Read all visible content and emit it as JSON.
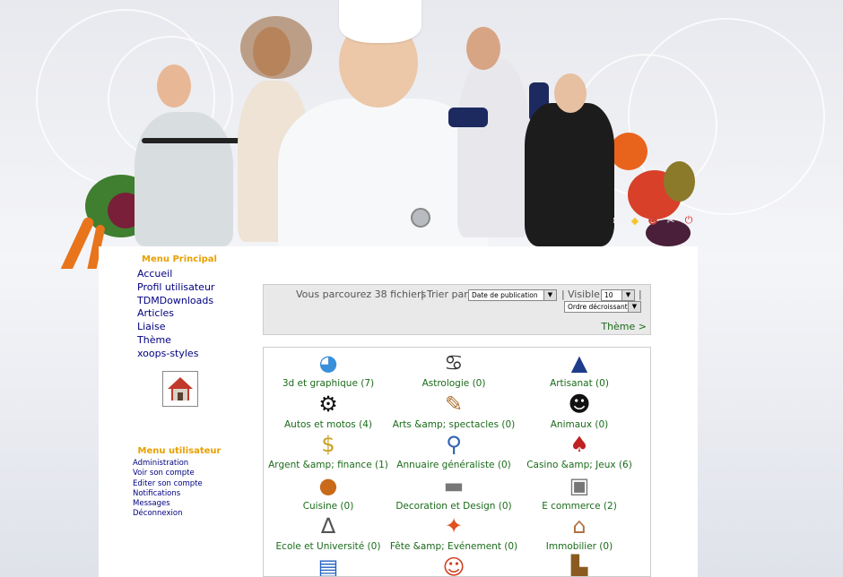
{
  "top_icons": [
    {
      "name": "mail-icon",
      "glyph": "✉",
      "color": "#f2f2f2"
    },
    {
      "name": "folder-icon",
      "glyph": "◆",
      "color": "#f4c430"
    },
    {
      "name": "profile-icon",
      "glyph": "☻",
      "color": "#d04030"
    },
    {
      "name": "tools-icon",
      "glyph": "✂",
      "color": "#ffffff"
    },
    {
      "name": "power-icon",
      "glyph": "⏻",
      "color": "#e02020"
    }
  ],
  "main_menu": {
    "title": "Menu Principal",
    "items": [
      "Accueil",
      "Profil utilisateur",
      "TDMDownloads",
      "Articles",
      "Liaise",
      "Thème",
      "xoops-styles"
    ]
  },
  "user_menu": {
    "title": "Menu utilisateur",
    "items": [
      "Administration",
      "Voir son compte",
      "Editer son compte",
      "Notifications",
      "Messages",
      "Déconnexion"
    ]
  },
  "toolbar": {
    "browse_text": "Vous parcourez 38 fichiers",
    "sep1": "|",
    "sort_label": "Trier par",
    "sort_value": "Date de publication",
    "sep2": "|",
    "visible_label": "Visible",
    "visible_value": "10",
    "sep3": "|",
    "order_value": "Ordre décroissant",
    "theme_link": "Thème >"
  },
  "categories": [
    {
      "label": "3d et graphique (7)",
      "icon": "pie-chart-icon",
      "glyph": "◕",
      "color": "#3a8fd9"
    },
    {
      "label": "Astrologie (0)",
      "icon": "crab-icon",
      "glyph": "♋",
      "color": "#333333"
    },
    {
      "label": "Artisanat (0)",
      "icon": "artisan-logo-icon",
      "glyph": "▲",
      "color": "#1e3c8c"
    },
    {
      "label": "Autos et motos (4)",
      "icon": "motorbike-icon",
      "glyph": "⚙",
      "color": "#111111"
    },
    {
      "label": "Arts &amp; spectacles (0)",
      "icon": "palette-icon",
      "glyph": "✎",
      "color": "#b07030"
    },
    {
      "label": "Animaux (0)",
      "icon": "panda-icon",
      "glyph": "☻",
      "color": "#111111"
    },
    {
      "label": "Argent &amp; finance (1)",
      "icon": "money-icon",
      "glyph": "$",
      "color": "#c9a020"
    },
    {
      "label": "Annuaire généraliste (0)",
      "icon": "magnifier-icon",
      "glyph": "⚲",
      "color": "#3060b0"
    },
    {
      "label": "Casino &amp; Jeux (6)",
      "icon": "cards-icon",
      "glyph": "♠",
      "color": "#c02020"
    },
    {
      "label": "Cuisine (0)",
      "icon": "burger-icon",
      "glyph": "●",
      "color": "#c86a1a"
    },
    {
      "label": "Decoration et Design (0)",
      "icon": "paint-roller-icon",
      "glyph": "▬",
      "color": "#777777"
    },
    {
      "label": "E commerce (2)",
      "icon": "cash-register-icon",
      "glyph": "▣",
      "color": "#777777"
    },
    {
      "label": "Ecole et Université (0)",
      "icon": "compass-icon",
      "glyph": "∆",
      "color": "#555555"
    },
    {
      "label": "Fête &amp; Evénement (0)",
      "icon": "party-icon",
      "glyph": "✦",
      "color": "#e05020"
    },
    {
      "label": "Immobilier (0)",
      "icon": "house-icon",
      "glyph": "⌂",
      "color": "#b07040"
    },
    {
      "label": "",
      "icon": "books-icon",
      "glyph": "▤",
      "color": "#2060c0"
    },
    {
      "label": "",
      "icon": "child-icon",
      "glyph": "☺",
      "color": "#d04020"
    },
    {
      "label": "",
      "icon": "boot-icon",
      "glyph": "▙",
      "color": "#8a5a20"
    }
  ]
}
